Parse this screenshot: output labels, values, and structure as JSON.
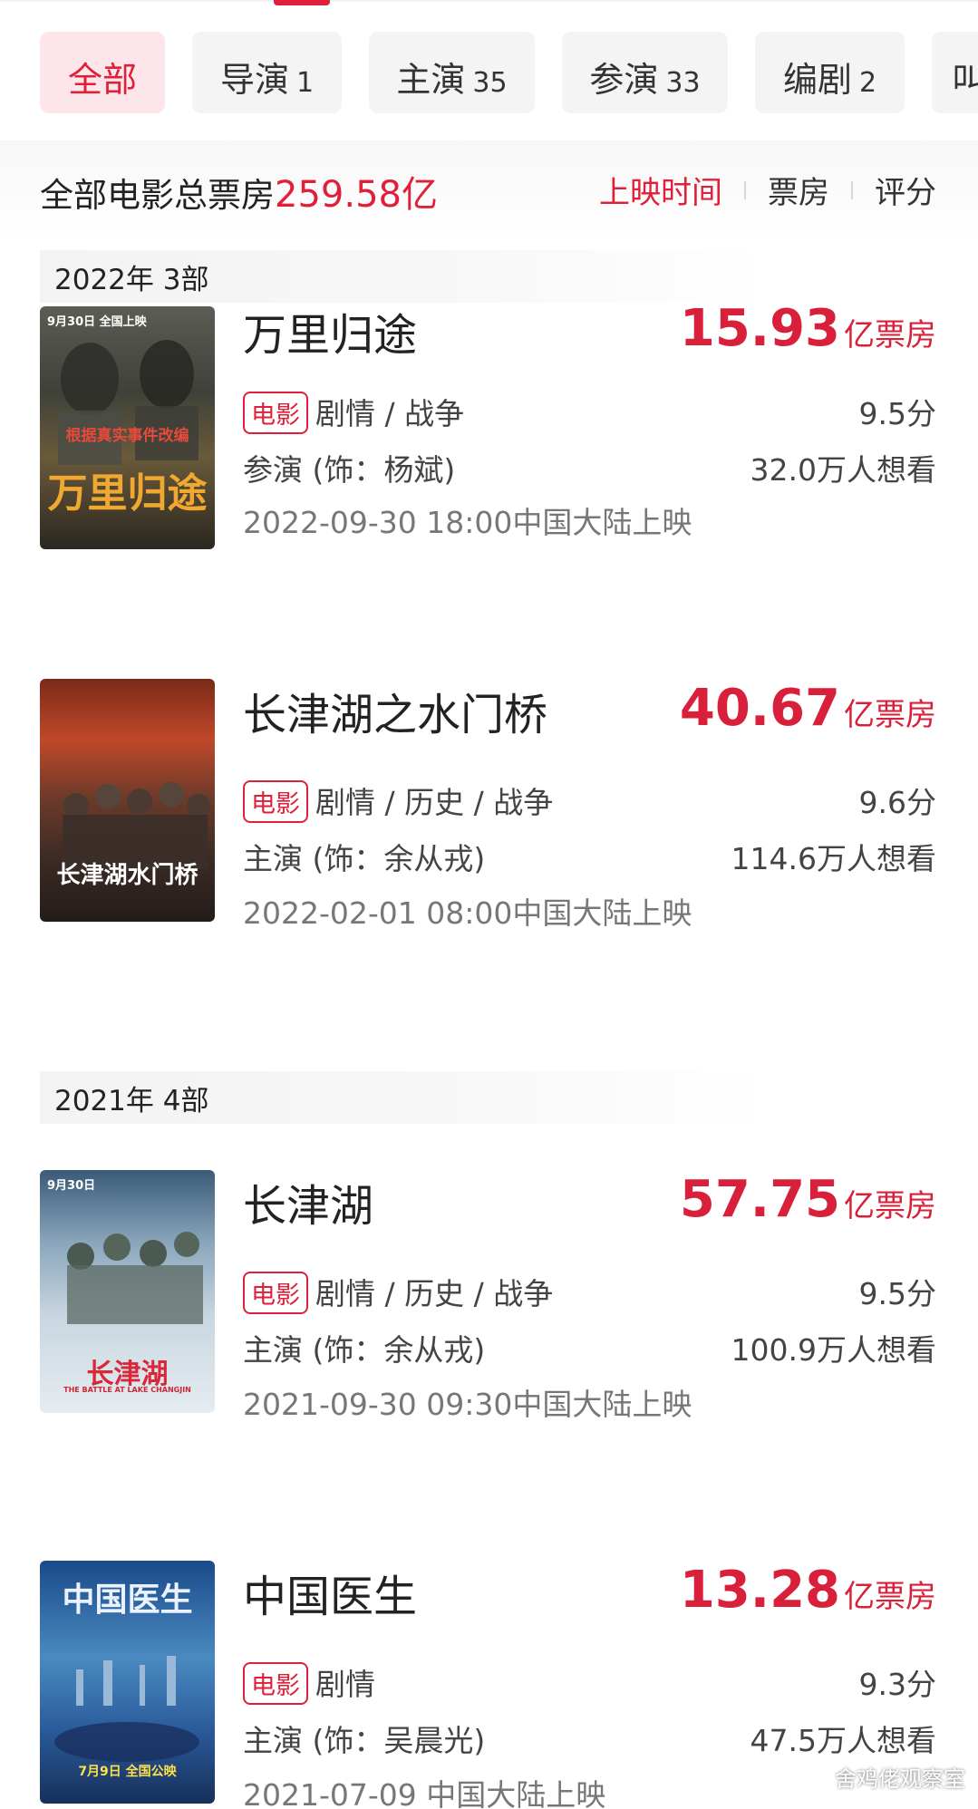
{
  "tabs": [
    {
      "label": "全部",
      "count": ""
    },
    {
      "label": "导演",
      "count": "1"
    },
    {
      "label": "主演",
      "count": "35"
    },
    {
      "label": "参演",
      "count": "33"
    },
    {
      "label": "编剧",
      "count": "2"
    },
    {
      "label": "叫",
      "count": ""
    }
  ],
  "summary": {
    "prefix": "全部电影总票房",
    "total": "259.58亿"
  },
  "sort": {
    "options": [
      "上映时间",
      "票房",
      "评分"
    ],
    "active": "上映时间"
  },
  "years": [
    {
      "label": "2022年 3部"
    },
    {
      "label": "2021年 4部"
    }
  ],
  "movies": [
    {
      "title": "万里归途",
      "box_office": "15.93",
      "box_unit": "亿票房",
      "tag": "电影",
      "genre": "剧情 / 战争",
      "score": "9.5分",
      "role": "参演 (饰：杨斌)",
      "want": "32.0万人想看",
      "release": "2022-09-30 18:00中国大陆上映",
      "poster_title": "万里归途",
      "poster_top": "9月30日 全国上映",
      "poster_sub": "根据真实事件改编"
    },
    {
      "title": "长津湖之水门桥",
      "box_office": "40.67",
      "box_unit": "亿票房",
      "tag": "电影",
      "genre": "剧情 / 历史 / 战争",
      "score": "9.6分",
      "role": "主演 (饰：余从戎)",
      "want": "114.6万人想看",
      "release": "2022-02-01 08:00中国大陆上映",
      "poster_title": "长津湖水门桥",
      "poster_top": "",
      "poster_sub": ""
    },
    {
      "title": "长津湖",
      "box_office": "57.75",
      "box_unit": "亿票房",
      "tag": "电影",
      "genre": "剧情 / 历史 / 战争",
      "score": "9.5分",
      "role": "主演 (饰：余从戎)",
      "want": "100.9万人想看",
      "release": "2021-09-30 09:30中国大陆上映",
      "poster_title": "长津湖",
      "poster_top": "9月30日",
      "poster_sub": "THE BATTLE AT LAKE CHANGJIN"
    },
    {
      "title": "中国医生",
      "box_office": "13.28",
      "box_unit": "亿票房",
      "tag": "电影",
      "genre": "剧情",
      "score": "9.3分",
      "role": "主演 (饰：吴晨光)",
      "want": "47.5万人想看",
      "release": "2021-07-09 中国大陆上映",
      "poster_title": "中国医生",
      "poster_top": "",
      "poster_sub": "7月9日 全国公映"
    }
  ],
  "watermark": "舍鸡佬观察室",
  "colors": {
    "accent": "#e0203a",
    "tab_active_bg": "#fde6ea"
  }
}
